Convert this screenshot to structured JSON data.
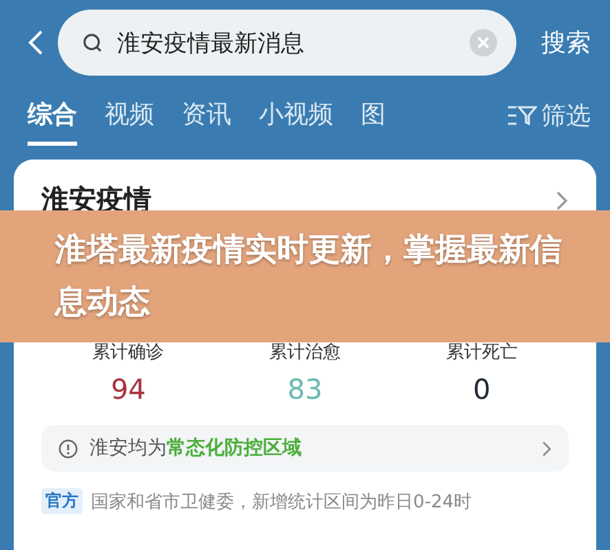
{
  "search": {
    "value": "淮安疫情最新消息",
    "button": "搜索"
  },
  "tabs": [
    {
      "label": "综合",
      "selected": true
    },
    {
      "label": "视频",
      "selected": false
    },
    {
      "label": "资讯",
      "selected": false
    },
    {
      "label": "小视频",
      "selected": false
    },
    {
      "label": "图",
      "selected": false
    }
  ],
  "filter": {
    "label": "筛选"
  },
  "card": {
    "title": "淮安疫情",
    "total_stats": [
      {
        "label": "累计确诊",
        "value": "94",
        "color": "#a8323f"
      },
      {
        "label": "累计治愈",
        "value": "83",
        "color": "#6bb8b2"
      },
      {
        "label": "累计死亡",
        "value": "0",
        "color": "#1f2a33"
      }
    ],
    "notice": "淮安均为**常态化防控区域**",
    "source_badge": "官方",
    "source": "国家和省市卫健委，新增统计区间为昨日0-24时"
  },
  "banner": {
    "title": "淮塔最新疫情实时更新，掌握最新信息动态"
  }
}
